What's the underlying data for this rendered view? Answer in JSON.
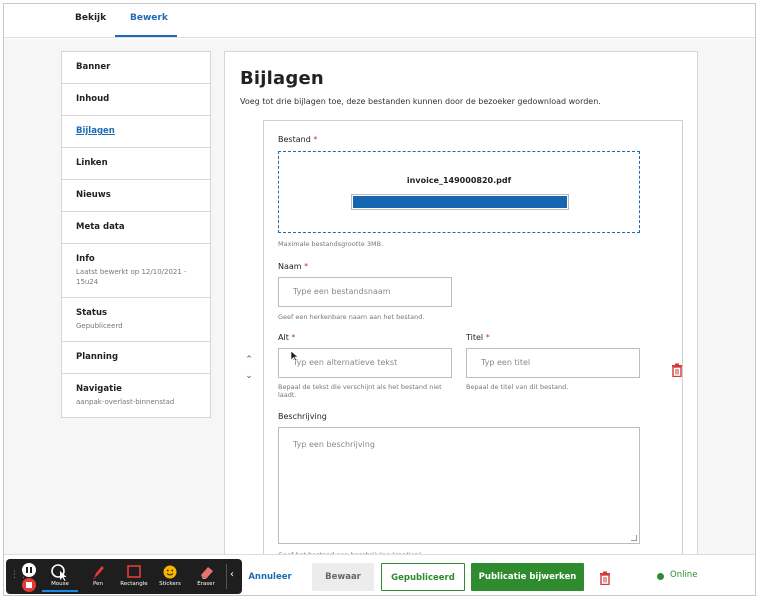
{
  "tabs": {
    "view": "Bekijk",
    "edit": "Bewerk"
  },
  "sidebar": {
    "items": [
      {
        "label": "Banner",
        "sub": ""
      },
      {
        "label": "Inhoud",
        "sub": ""
      },
      {
        "label": "Bijlagen",
        "sub": "",
        "active": true
      },
      {
        "label": "Linken",
        "sub": ""
      },
      {
        "label": "Nieuws",
        "sub": ""
      },
      {
        "label": "Meta data",
        "sub": ""
      },
      {
        "label": "Info",
        "sub": "Laatst bewerkt op 12/10/2021 - 15u24"
      },
      {
        "label": "Status",
        "sub": "Gepubliceerd"
      },
      {
        "label": "Planning",
        "sub": ""
      },
      {
        "label": "Navigatie",
        "sub": "aanpak-overlast-binnenstad"
      }
    ]
  },
  "main": {
    "title": "Bijlagen",
    "description": "Voeg tot drie bijlagen toe, deze bestanden kunnen door de bezoeker gedownload worden.",
    "attachment": {
      "file_label": "Bestand",
      "required_mark": "*",
      "file_name": "invoice_149000820.pdf",
      "upload_progress": 1.0,
      "file_hint": "Maximale bestandsgrootte 3MB.",
      "name_label": "Naam",
      "name_placeholder": "Type een bestandsnaam",
      "name_hint": "Geef een herkenbare naam aan het bestand.",
      "alt_label": "Alt",
      "alt_placeholder": "Typ een alternatieve tekst",
      "alt_hint": "Bepaal de tekst die verschijnt als het bestand niet laadt.",
      "title_label": "Titel",
      "title_placeholder": "Typ een titel",
      "title_hint": "Bepaal de titel van dit bestand.",
      "desc_label": "Beschrijving",
      "desc_placeholder": "Typ een beschrijving",
      "desc_hint": "Geef het bestand een beschrijving (caption)."
    }
  },
  "footer": {
    "cancel": "Annuleer",
    "save": "Bewaar",
    "published": "Gepubliceerd",
    "update_publication": "Publicatie bijwerken",
    "status": "Online"
  },
  "recorder": {
    "tools": [
      "Mouse",
      "Pen",
      "Rectangle",
      "Stickers",
      "Eraser"
    ]
  },
  "colors": {
    "accent": "#1e6bb8",
    "success": "#2e8b2e",
    "danger": "#e53935",
    "progress": "#1565b0"
  }
}
